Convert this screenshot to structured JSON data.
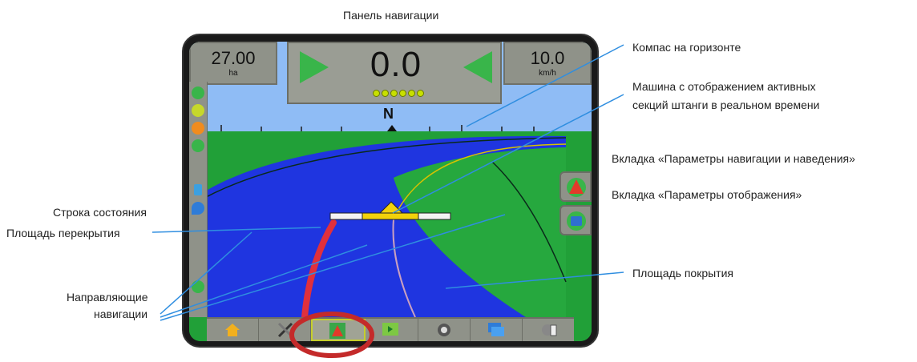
{
  "annotations": {
    "nav_panel": "Панель навигации",
    "horizon_compass": "Компас на горизонте",
    "machine_line1": "Машина с отображением активных",
    "machine_line2": "секций штанги в реальном времени",
    "nav_guidance_tab": "Вкладка «Параметры навигации и наведения»",
    "display_tab": "Вкладка «Параметры отображения»",
    "status_bar": "Строка состояния",
    "overlap_area": "Площадь перекрытия",
    "coverage_area": "Площадь покрытия",
    "guidelines_line1": "Направляющие",
    "guidelines_line2": "навигации"
  },
  "screen": {
    "area_value": "27.00",
    "area_unit": "ha",
    "guidance_value": "0.0",
    "speed_value": "10.0",
    "speed_unit": "km/h",
    "compass_letter": "N",
    "bottom_buttons": [
      "home-icon",
      "tools-icon",
      "vehicle-view-icon",
      "field-view-icon",
      "camera-icon",
      "layers-icon",
      "info-icon"
    ],
    "active_button": "vehicle-view-icon"
  },
  "colors": {
    "sky": "#8fbcf5",
    "field": "#21a038",
    "coverage": "#1f35e0",
    "overlap": "#e0303c",
    "highlight_circle": "#c42a2a",
    "annotation_line": "#2f8ee0"
  }
}
